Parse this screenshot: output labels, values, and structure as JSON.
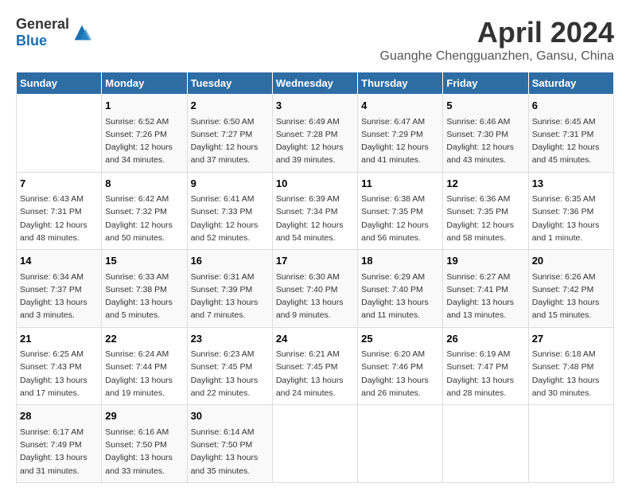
{
  "header": {
    "logo_general": "General",
    "logo_blue": "Blue",
    "title": "April 2024",
    "location": "Guanghe Chengguanzhen, Gansu, China"
  },
  "calendar": {
    "days_of_week": [
      "Sunday",
      "Monday",
      "Tuesday",
      "Wednesday",
      "Thursday",
      "Friday",
      "Saturday"
    ],
    "weeks": [
      [
        {
          "day": "",
          "info": ""
        },
        {
          "day": "1",
          "info": "Sunrise: 6:52 AM\nSunset: 7:26 PM\nDaylight: 12 hours\nand 34 minutes."
        },
        {
          "day": "2",
          "info": "Sunrise: 6:50 AM\nSunset: 7:27 PM\nDaylight: 12 hours\nand 37 minutes."
        },
        {
          "day": "3",
          "info": "Sunrise: 6:49 AM\nSunset: 7:28 PM\nDaylight: 12 hours\nand 39 minutes."
        },
        {
          "day": "4",
          "info": "Sunrise: 6:47 AM\nSunset: 7:29 PM\nDaylight: 12 hours\nand 41 minutes."
        },
        {
          "day": "5",
          "info": "Sunrise: 6:46 AM\nSunset: 7:30 PM\nDaylight: 12 hours\nand 43 minutes."
        },
        {
          "day": "6",
          "info": "Sunrise: 6:45 AM\nSunset: 7:31 PM\nDaylight: 12 hours\nand 45 minutes."
        }
      ],
      [
        {
          "day": "7",
          "info": "Sunrise: 6:43 AM\nSunset: 7:31 PM\nDaylight: 12 hours\nand 48 minutes."
        },
        {
          "day": "8",
          "info": "Sunrise: 6:42 AM\nSunset: 7:32 PM\nDaylight: 12 hours\nand 50 minutes."
        },
        {
          "day": "9",
          "info": "Sunrise: 6:41 AM\nSunset: 7:33 PM\nDaylight: 12 hours\nand 52 minutes."
        },
        {
          "day": "10",
          "info": "Sunrise: 6:39 AM\nSunset: 7:34 PM\nDaylight: 12 hours\nand 54 minutes."
        },
        {
          "day": "11",
          "info": "Sunrise: 6:38 AM\nSunset: 7:35 PM\nDaylight: 12 hours\nand 56 minutes."
        },
        {
          "day": "12",
          "info": "Sunrise: 6:36 AM\nSunset: 7:35 PM\nDaylight: 12 hours\nand 58 minutes."
        },
        {
          "day": "13",
          "info": "Sunrise: 6:35 AM\nSunset: 7:36 PM\nDaylight: 13 hours\nand 1 minute."
        }
      ],
      [
        {
          "day": "14",
          "info": "Sunrise: 6:34 AM\nSunset: 7:37 PM\nDaylight: 13 hours\nand 3 minutes."
        },
        {
          "day": "15",
          "info": "Sunrise: 6:33 AM\nSunset: 7:38 PM\nDaylight: 13 hours\nand 5 minutes."
        },
        {
          "day": "16",
          "info": "Sunrise: 6:31 AM\nSunset: 7:39 PM\nDaylight: 13 hours\nand 7 minutes."
        },
        {
          "day": "17",
          "info": "Sunrise: 6:30 AM\nSunset: 7:40 PM\nDaylight: 13 hours\nand 9 minutes."
        },
        {
          "day": "18",
          "info": "Sunrise: 6:29 AM\nSunset: 7:40 PM\nDaylight: 13 hours\nand 11 minutes."
        },
        {
          "day": "19",
          "info": "Sunrise: 6:27 AM\nSunset: 7:41 PM\nDaylight: 13 hours\nand 13 minutes."
        },
        {
          "day": "20",
          "info": "Sunrise: 6:26 AM\nSunset: 7:42 PM\nDaylight: 13 hours\nand 15 minutes."
        }
      ],
      [
        {
          "day": "21",
          "info": "Sunrise: 6:25 AM\nSunset: 7:43 PM\nDaylight: 13 hours\nand 17 minutes."
        },
        {
          "day": "22",
          "info": "Sunrise: 6:24 AM\nSunset: 7:44 PM\nDaylight: 13 hours\nand 19 minutes."
        },
        {
          "day": "23",
          "info": "Sunrise: 6:23 AM\nSunset: 7:45 PM\nDaylight: 13 hours\nand 22 minutes."
        },
        {
          "day": "24",
          "info": "Sunrise: 6:21 AM\nSunset: 7:45 PM\nDaylight: 13 hours\nand 24 minutes."
        },
        {
          "day": "25",
          "info": "Sunrise: 6:20 AM\nSunset: 7:46 PM\nDaylight: 13 hours\nand 26 minutes."
        },
        {
          "day": "26",
          "info": "Sunrise: 6:19 AM\nSunset: 7:47 PM\nDaylight: 13 hours\nand 28 minutes."
        },
        {
          "day": "27",
          "info": "Sunrise: 6:18 AM\nSunset: 7:48 PM\nDaylight: 13 hours\nand 30 minutes."
        }
      ],
      [
        {
          "day": "28",
          "info": "Sunrise: 6:17 AM\nSunset: 7:49 PM\nDaylight: 13 hours\nand 31 minutes."
        },
        {
          "day": "29",
          "info": "Sunrise: 6:16 AM\nSunset: 7:50 PM\nDaylight: 13 hours\nand 33 minutes."
        },
        {
          "day": "30",
          "info": "Sunrise: 6:14 AM\nSunset: 7:50 PM\nDaylight: 13 hours\nand 35 minutes."
        },
        {
          "day": "",
          "info": ""
        },
        {
          "day": "",
          "info": ""
        },
        {
          "day": "",
          "info": ""
        },
        {
          "day": "",
          "info": ""
        }
      ]
    ]
  }
}
